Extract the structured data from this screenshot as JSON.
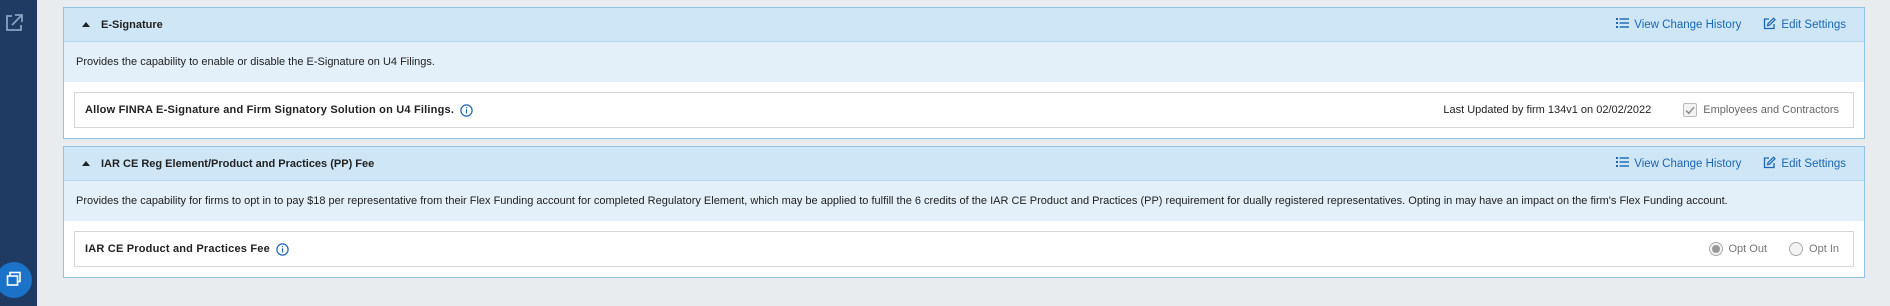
{
  "rail": {
    "top_icon": "external-link-icon",
    "fab_icon": "windows-icon"
  },
  "sections": [
    {
      "title": "E-Signature",
      "view_history_label": "View Change History",
      "edit_settings_label": "Edit Settings",
      "description": "Provides the capability to enable or disable the E-Signature on U4 Filings.",
      "row_label": "Allow FINRA E-Signature and Firm Signatory Solution on U4 Filings.",
      "last_updated": "Last Updated by firm 134v1 on 02/02/2022",
      "checkbox_label": "Employees and Contractors",
      "checkbox_checked": true
    },
    {
      "title": "IAR CE Reg Element/Product and Practices (PP) Fee",
      "view_history_label": "View Change History",
      "edit_settings_label": "Edit Settings",
      "description": "Provides the capability for firms to opt in to pay $18 per representative from their Flex Funding account for completed Regulatory Element, which may be applied to fulfill the 6 credits of the IAR CE Product and Practices (PP) requirement for dually registered representatives. Opting in may have an impact on the firm's Flex Funding account.",
      "row_label": "IAR CE Product and Practices Fee",
      "radio_opt_out": "Opt Out",
      "radio_opt_in": "Opt In",
      "selected": "Opt Out"
    }
  ],
  "colors": {
    "accent": "#1b67b3",
    "header_bg": "#cfe6f6",
    "desc_bg": "#e3f0f9",
    "rail": "#1f3b63"
  }
}
